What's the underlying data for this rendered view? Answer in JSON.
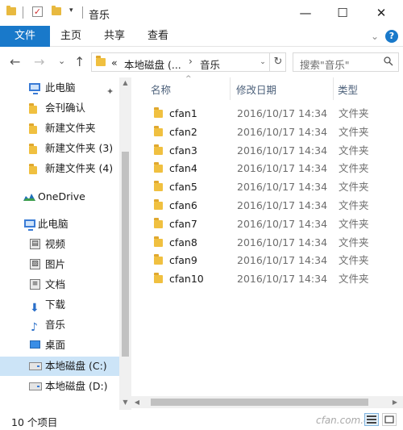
{
  "window": {
    "title": "音乐",
    "minimize_glyph": "—",
    "maximize_glyph": "☐",
    "close_glyph": "✕"
  },
  "ribbon": {
    "tabs": [
      "文件",
      "主页",
      "共享",
      "查看"
    ],
    "expand_glyph": "⌄",
    "help_glyph": "?"
  },
  "nav": {
    "back_glyph": "←",
    "forward_glyph": "→",
    "recent_glyph": "⌄",
    "up_glyph": "↑"
  },
  "address": {
    "overflow": "«",
    "crumbs": [
      "本地磁盘 (...",
      "音乐"
    ],
    "separator": "›",
    "dropdown_glyph": "⌄",
    "refresh_glyph": "↻"
  },
  "search": {
    "placeholder": "搜索\"音乐\""
  },
  "sidebar": {
    "quick_access": [
      {
        "label": "此电脑",
        "icon": "pc-icon",
        "pinned": true
      },
      {
        "label": "会刊确认",
        "icon": "folder-icon"
      },
      {
        "label": "新建文件夹",
        "icon": "folder-icon"
      },
      {
        "label": "新建文件夹 (3)",
        "icon": "folder-icon"
      },
      {
        "label": "新建文件夹 (4)",
        "icon": "folder-icon"
      }
    ],
    "onedrive": "OneDrive",
    "this_pc": "此电脑",
    "pc_items": [
      {
        "label": "视频",
        "icon": "video-icon"
      },
      {
        "label": "图片",
        "icon": "picture-icon"
      },
      {
        "label": "文档",
        "icon": "document-icon"
      },
      {
        "label": "下载",
        "icon": "download-icon"
      },
      {
        "label": "音乐",
        "icon": "music-icon"
      },
      {
        "label": "桌面",
        "icon": "desktop-icon"
      },
      {
        "label": "本地磁盘 (C:)",
        "icon": "drive-icon",
        "selected": true
      },
      {
        "label": "本地磁盘 (D:)",
        "icon": "drive-icon"
      }
    ],
    "pin_glyph": "📌"
  },
  "columns": {
    "name": "名称",
    "date": "修改日期",
    "type": "类型",
    "sort_glyph": "^"
  },
  "files": [
    {
      "name": "cfan1",
      "date": "2016/10/17 14:34",
      "type": "文件夹"
    },
    {
      "name": "cfan2",
      "date": "2016/10/17 14:34",
      "type": "文件夹"
    },
    {
      "name": "cfan3",
      "date": "2016/10/17 14:34",
      "type": "文件夹"
    },
    {
      "name": "cfan4",
      "date": "2016/10/17 14:34",
      "type": "文件夹"
    },
    {
      "name": "cfan5",
      "date": "2016/10/17 14:34",
      "type": "文件夹"
    },
    {
      "name": "cfan6",
      "date": "2016/10/17 14:34",
      "type": "文件夹"
    },
    {
      "name": "cfan7",
      "date": "2016/10/17 14:34",
      "type": "文件夹"
    },
    {
      "name": "cfan8",
      "date": "2016/10/17 14:34",
      "type": "文件夹"
    },
    {
      "name": "cfan9",
      "date": "2016/10/17 14:34",
      "type": "文件夹"
    },
    {
      "name": "cfan10",
      "date": "2016/10/17 14:34",
      "type": "文件夹"
    }
  ],
  "status": {
    "count": "10 个项目",
    "watermark": "cfan.com.cn"
  },
  "colors": {
    "accent": "#1979ca",
    "selection": "#cce4f7",
    "folder": "#f0c040"
  }
}
